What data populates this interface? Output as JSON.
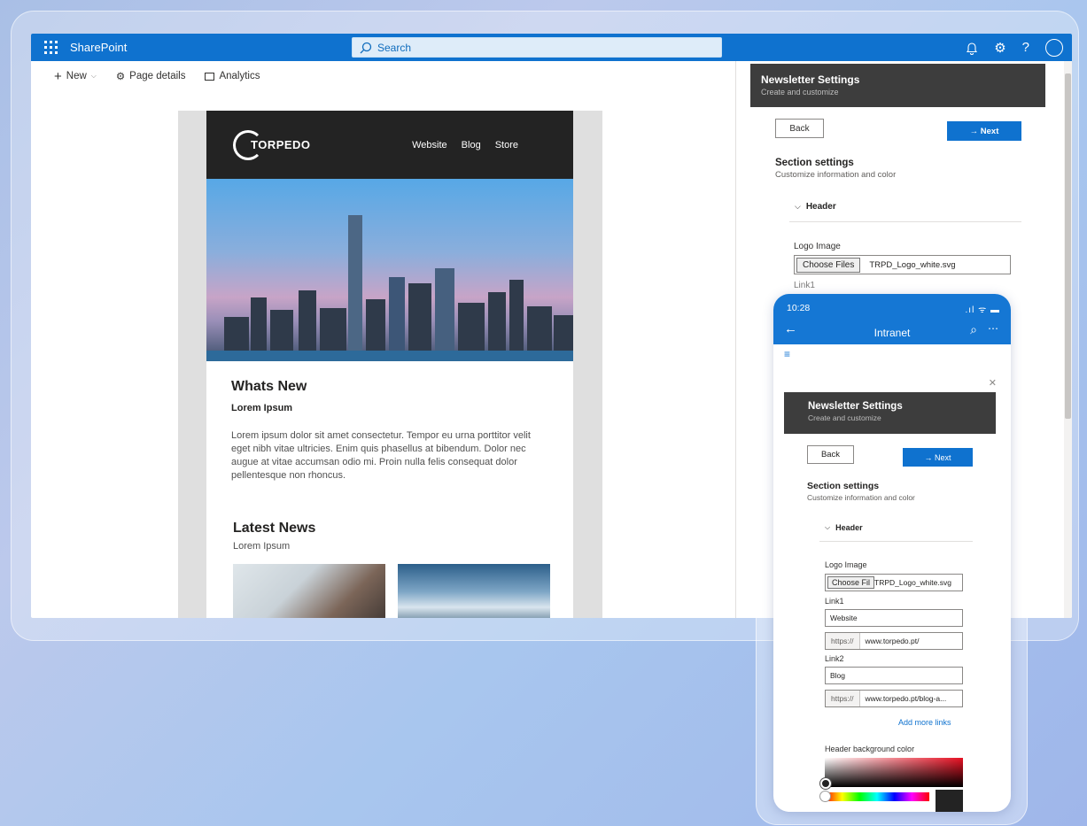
{
  "suitebar": {
    "brand": "SharePoint",
    "search_placeholder": "Search",
    "color": "#0f72cf"
  },
  "commandbar": {
    "new_label": "New",
    "page_details_label": "Page details",
    "analytics_label": "Analytics"
  },
  "newsletter": {
    "logo_text": "TORPEDO",
    "nav": [
      "Website",
      "Blog",
      "Store"
    ],
    "whats_new_title": "Whats New",
    "whats_new_sub": "Lorem Ipsum",
    "whats_new_body": "Lorem ipsum dolor sit amet consectetur. Tempor eu urna porttitor velit eget nibh vitae ultricies. Enim quis phasellus at bibendum. Dolor nec augue at vitae accumsan odio mi. Proin nulla felis consequat dolor pellentesque non rhoncus.",
    "latest_title": "Latest News",
    "latest_sub": "Lorem Ipsum"
  },
  "panel": {
    "title": "Newsletter Settings",
    "subtitle": "Create and customize",
    "back_label": "Back",
    "next_label": "→ Next",
    "section_title": "Section settings",
    "section_sub": "Customize information and color",
    "accordion_label": "Header",
    "logo_label": "Logo Image",
    "choose_files_label": "Choose Files",
    "logo_file": "TRPD_Logo_white.svg",
    "link1_label": "Link1"
  },
  "phone": {
    "time": "10:28",
    "status": ".ıl ᯤ ▬",
    "title": "Intranet",
    "panel_title": "Newsletter Settings",
    "panel_sub": "Create and customize",
    "back_label": "Back",
    "next_label": "→ Next",
    "section_title": "Section settings",
    "section_sub": "Customize information and color",
    "accordion_label": "Header",
    "logo_label": "Logo Image",
    "choose_files_label": "Choose Fil",
    "logo_file": "TRPD_Logo_white.svg",
    "link1_label": "Link1",
    "link1_text": "Website",
    "link1_prefix": "https://",
    "link1_url": "www.torpedo.pt/",
    "link2_label": "Link2",
    "link2_text": "Blog",
    "link2_prefix": "https://",
    "link2_url": "www.torpedo.pt/blog-a...",
    "add_more_links": "Add more links",
    "header_bg_label": "Header background color",
    "header_bg_color": "#232323"
  }
}
